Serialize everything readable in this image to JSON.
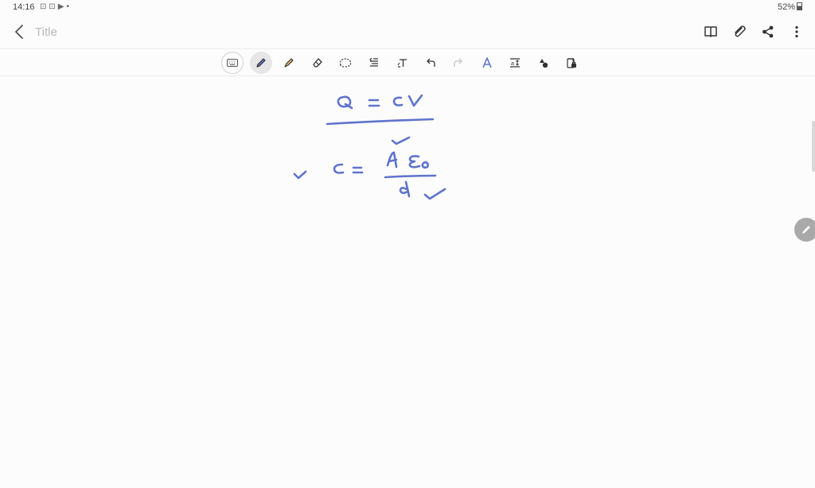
{
  "status_bar": {
    "time": "14:16",
    "status_icons": [
      "screenshot-icon",
      "screenshot-icon",
      "play-store-icon",
      "dot-icon"
    ],
    "battery": "52%"
  },
  "header": {
    "title_placeholder": "Title",
    "actions": [
      "book-icon",
      "attach-icon",
      "share-icon",
      "more-icon"
    ]
  },
  "toolbar": {
    "tools": [
      "keyboard",
      "pen",
      "highlighter",
      "eraser",
      "lasso",
      "text-align",
      "text-box",
      "undo",
      "redo",
      "ai-assist",
      "text-format",
      "shapes",
      "lock"
    ],
    "active_tool": "pen"
  },
  "canvas": {
    "ink_color": "#5f74cc",
    "line1": {
      "lhs": "Q",
      "eq": "=",
      "rhs": "CV"
    },
    "line2": {
      "check": "✓",
      "lhs": "C",
      "eq": "=",
      "numerator": "A ε₀",
      "denominator": "d"
    }
  }
}
